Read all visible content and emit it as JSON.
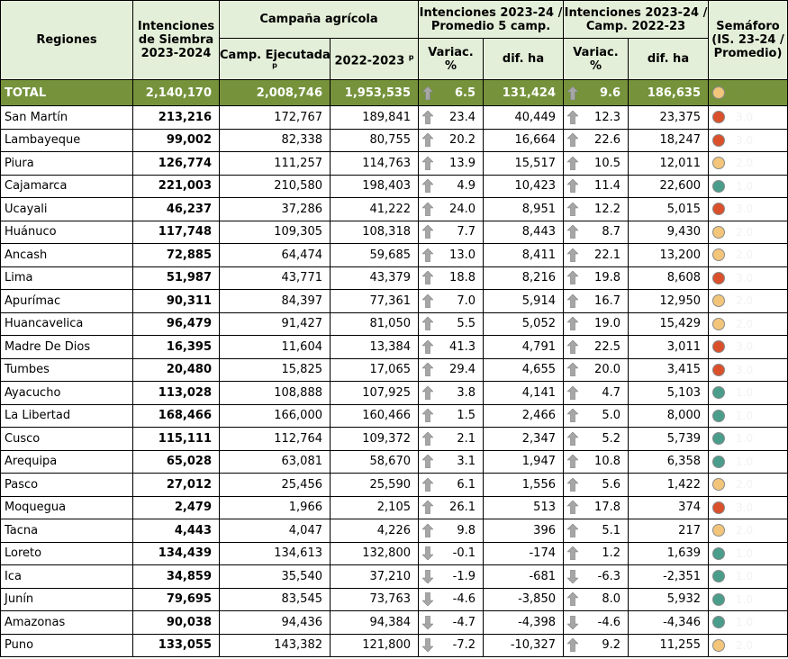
{
  "header": {
    "regions": "Regiones",
    "intentions_l1": "Intenciones",
    "intentions_l2": "de Siembra",
    "intentions_l3": "2023-2024",
    "campaign": "Campaña agrícola",
    "executed": "Camp. Ejecutadas",
    "executed_note": "p",
    "prev_season": "2022-2023",
    "prev_note": "p",
    "g1_l1": "Intenciones 2023-24 /",
    "g1_l2": "Promedio 5 camp.",
    "g2_l1": "Intenciones 2023-24 /",
    "g2_l2": "Camp. 2022-23",
    "variac_l1": "Variac.",
    "variac_l2": "%",
    "dif": "dif. ha",
    "sem_l1": "Semáforo",
    "sem_l2": "(IS. 23-24 /",
    "sem_l3": "Promedio)"
  },
  "colors": {
    "up": "#a6a6a6",
    "down": "#a6a6a6",
    "red": "#d9502b",
    "yellow": "#f2c57a",
    "green": "#4a9d8a",
    "total_bg": "#76933c",
    "header_bg": "#e4efd9"
  },
  "total": {
    "name": "TOTAL",
    "intent": "2,140,170",
    "exec": "2,008,746",
    "prev": "1,953,535",
    "v1": "6.5",
    "d1": "131,424",
    "v2": "9.6",
    "d2": "186,635",
    "a1": "up",
    "a2": "up",
    "sem": "yellow",
    "semval": "2.0"
  },
  "rows": [
    {
      "name": "San Martín",
      "intent": "213,216",
      "exec": "172,767",
      "prev": "189,841",
      "a1": "up",
      "v1": "23.4",
      "d1": "40,449",
      "a2": "up",
      "v2": "12.3",
      "d2": "23,375",
      "sem": "red",
      "semval": "3.0"
    },
    {
      "name": "Lambayeque",
      "intent": "99,002",
      "exec": "82,338",
      "prev": "80,755",
      "a1": "up",
      "v1": "20.2",
      "d1": "16,664",
      "a2": "up",
      "v2": "22.6",
      "d2": "18,247",
      "sem": "red",
      "semval": "3.0"
    },
    {
      "name": "Piura",
      "intent": "126,774",
      "exec": "111,257",
      "prev": "114,763",
      "a1": "up",
      "v1": "13.9",
      "d1": "15,517",
      "a2": "up",
      "v2": "10.5",
      "d2": "12,011",
      "sem": "yellow",
      "semval": "2.0"
    },
    {
      "name": "Cajamarca",
      "intent": "221,003",
      "exec": "210,580",
      "prev": "198,403",
      "a1": "up",
      "v1": "4.9",
      "d1": "10,423",
      "a2": "up",
      "v2": "11.4",
      "d2": "22,600",
      "sem": "green",
      "semval": "1.0"
    },
    {
      "name": "Ucayali",
      "intent": "46,237",
      "exec": "37,286",
      "prev": "41,222",
      "a1": "up",
      "v1": "24.0",
      "d1": "8,951",
      "a2": "up",
      "v2": "12.2",
      "d2": "5,015",
      "sem": "red",
      "semval": "3.0"
    },
    {
      "name": "Huánuco",
      "intent": "117,748",
      "exec": "109,305",
      "prev": "108,318",
      "a1": "up",
      "v1": "7.7",
      "d1": "8,443",
      "a2": "up",
      "v2": "8.7",
      "d2": "9,430",
      "sem": "yellow",
      "semval": "2.0"
    },
    {
      "name": "Ancash",
      "intent": "72,885",
      "exec": "64,474",
      "prev": "59,685",
      "a1": "up",
      "v1": "13.0",
      "d1": "8,411",
      "a2": "up",
      "v2": "22.1",
      "d2": "13,200",
      "sem": "yellow",
      "semval": "2.0"
    },
    {
      "name": "Lima",
      "intent": "51,987",
      "exec": "43,771",
      "prev": "43,379",
      "a1": "up",
      "v1": "18.8",
      "d1": "8,216",
      "a2": "up",
      "v2": "19.8",
      "d2": "8,608",
      "sem": "red",
      "semval": "3.0"
    },
    {
      "name": "Apurímac",
      "intent": "90,311",
      "exec": "84,397",
      "prev": "77,361",
      "a1": "up",
      "v1": "7.0",
      "d1": "5,914",
      "a2": "up",
      "v2": "16.7",
      "d2": "12,950",
      "sem": "yellow",
      "semval": "2.0"
    },
    {
      "name": "Huancavelica",
      "intent": "96,479",
      "exec": "91,427",
      "prev": "81,050",
      "a1": "up",
      "v1": "5.5",
      "d1": "5,052",
      "a2": "up",
      "v2": "19.0",
      "d2": "15,429",
      "sem": "yellow",
      "semval": "2.0"
    },
    {
      "name": "Madre De Dios",
      "intent": "16,395",
      "exec": "11,604",
      "prev": "13,384",
      "a1": "up",
      "v1": "41.3",
      "d1": "4,791",
      "a2": "up",
      "v2": "22.5",
      "d2": "3,011",
      "sem": "red",
      "semval": "3.0"
    },
    {
      "name": "Tumbes",
      "intent": "20,480",
      "exec": "15,825",
      "prev": "17,065",
      "a1": "up",
      "v1": "29.4",
      "d1": "4,655",
      "a2": "up",
      "v2": "20.0",
      "d2": "3,415",
      "sem": "red",
      "semval": "3.0"
    },
    {
      "name": "Ayacucho",
      "intent": "113,028",
      "exec": "108,888",
      "prev": "107,925",
      "a1": "up",
      "v1": "3.8",
      "d1": "4,141",
      "a2": "up",
      "v2": "4.7",
      "d2": "5,103",
      "sem": "green",
      "semval": "1.0"
    },
    {
      "name": "La Libertad",
      "intent": "168,466",
      "exec": "166,000",
      "prev": "160,466",
      "a1": "up",
      "v1": "1.5",
      "d1": "2,466",
      "a2": "up",
      "v2": "5.0",
      "d2": "8,000",
      "sem": "green",
      "semval": "1.0"
    },
    {
      "name": "Cusco",
      "intent": "115,111",
      "exec": "112,764",
      "prev": "109,372",
      "a1": "up",
      "v1": "2.1",
      "d1": "2,347",
      "a2": "up",
      "v2": "5.2",
      "d2": "5,739",
      "sem": "green",
      "semval": "1.0"
    },
    {
      "name": "Arequipa",
      "intent": "65,028",
      "exec": "63,081",
      "prev": "58,670",
      "a1": "up",
      "v1": "3.1",
      "d1": "1,947",
      "a2": "up",
      "v2": "10.8",
      "d2": "6,358",
      "sem": "green",
      "semval": "1.0"
    },
    {
      "name": "Pasco",
      "intent": "27,012",
      "exec": "25,456",
      "prev": "25,590",
      "a1": "up",
      "v1": "6.1",
      "d1": "1,556",
      "a2": "up",
      "v2": "5.6",
      "d2": "1,422",
      "sem": "yellow",
      "semval": "2.0"
    },
    {
      "name": "Moquegua",
      "intent": "2,479",
      "exec": "1,966",
      "prev": "2,105",
      "a1": "up",
      "v1": "26.1",
      "d1": "513",
      "a2": "up",
      "v2": "17.8",
      "d2": "374",
      "sem": "red",
      "semval": "3.0"
    },
    {
      "name": "Tacna",
      "intent": "4,443",
      "exec": "4,047",
      "prev": "4,226",
      "a1": "up",
      "v1": "9.8",
      "d1": "396",
      "a2": "up",
      "v2": "5.1",
      "d2": "217",
      "sem": "yellow",
      "semval": "2.0"
    },
    {
      "name": "Loreto",
      "intent": "134,439",
      "exec": "134,613",
      "prev": "132,800",
      "a1": "down",
      "v1": "-0.1",
      "d1": "-174",
      "a2": "up",
      "v2": "1.2",
      "d2": "1,639",
      "sem": "green",
      "semval": "1.0"
    },
    {
      "name": "Ica",
      "intent": "34,859",
      "exec": "35,540",
      "prev": "37,210",
      "a1": "down",
      "v1": "-1.9",
      "d1": "-681",
      "a2": "down",
      "v2": "-6.3",
      "d2": "-2,351",
      "sem": "green",
      "semval": "1.0"
    },
    {
      "name": "Junín",
      "intent": "79,695",
      "exec": "83,545",
      "prev": "73,763",
      "a1": "down",
      "v1": "-4.6",
      "d1": "-3,850",
      "a2": "up",
      "v2": "8.0",
      "d2": "5,932",
      "sem": "green",
      "semval": "1.0"
    },
    {
      "name": "Amazonas",
      "intent": "90,038",
      "exec": "94,436",
      "prev": "94,384",
      "a1": "down",
      "v1": "-4.7",
      "d1": "-4,398",
      "a2": "down",
      "v2": "-4.6",
      "d2": "-4,346",
      "sem": "green",
      "semval": "1.0"
    },
    {
      "name": "Puno",
      "intent": "133,055",
      "exec": "143,382",
      "prev": "121,800",
      "a1": "down",
      "v1": "-7.2",
      "d1": "-10,327",
      "a2": "up",
      "v2": "9.2",
      "d2": "11,255",
      "sem": "yellow",
      "semval": "2.0"
    }
  ]
}
